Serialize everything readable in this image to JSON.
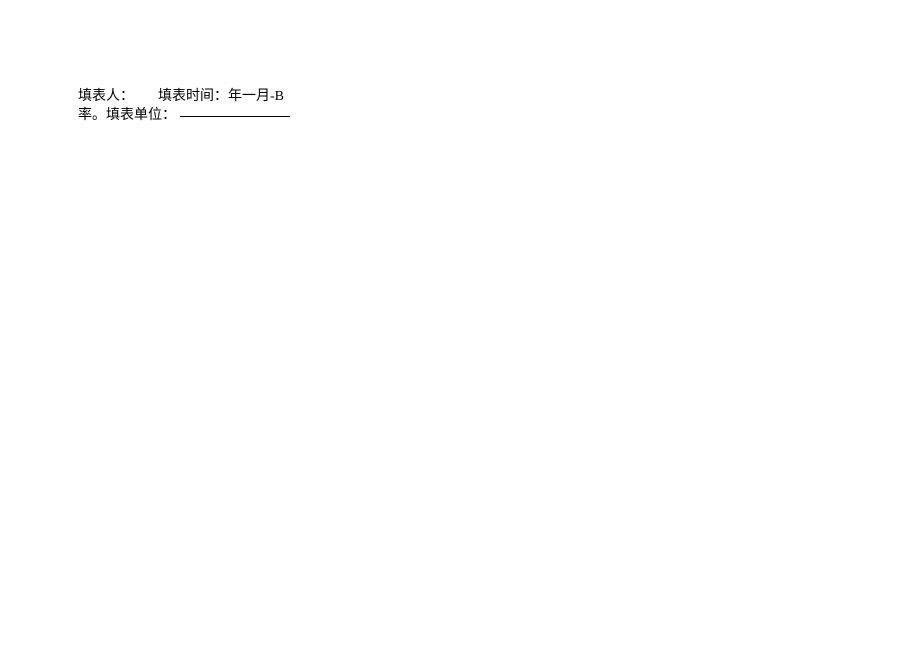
{
  "form": {
    "filler_label": "填表人：",
    "time_label": "填表时间：",
    "time_value": "年一月-B",
    "line2_prefix": "率。",
    "unit_label": "填表单位："
  }
}
